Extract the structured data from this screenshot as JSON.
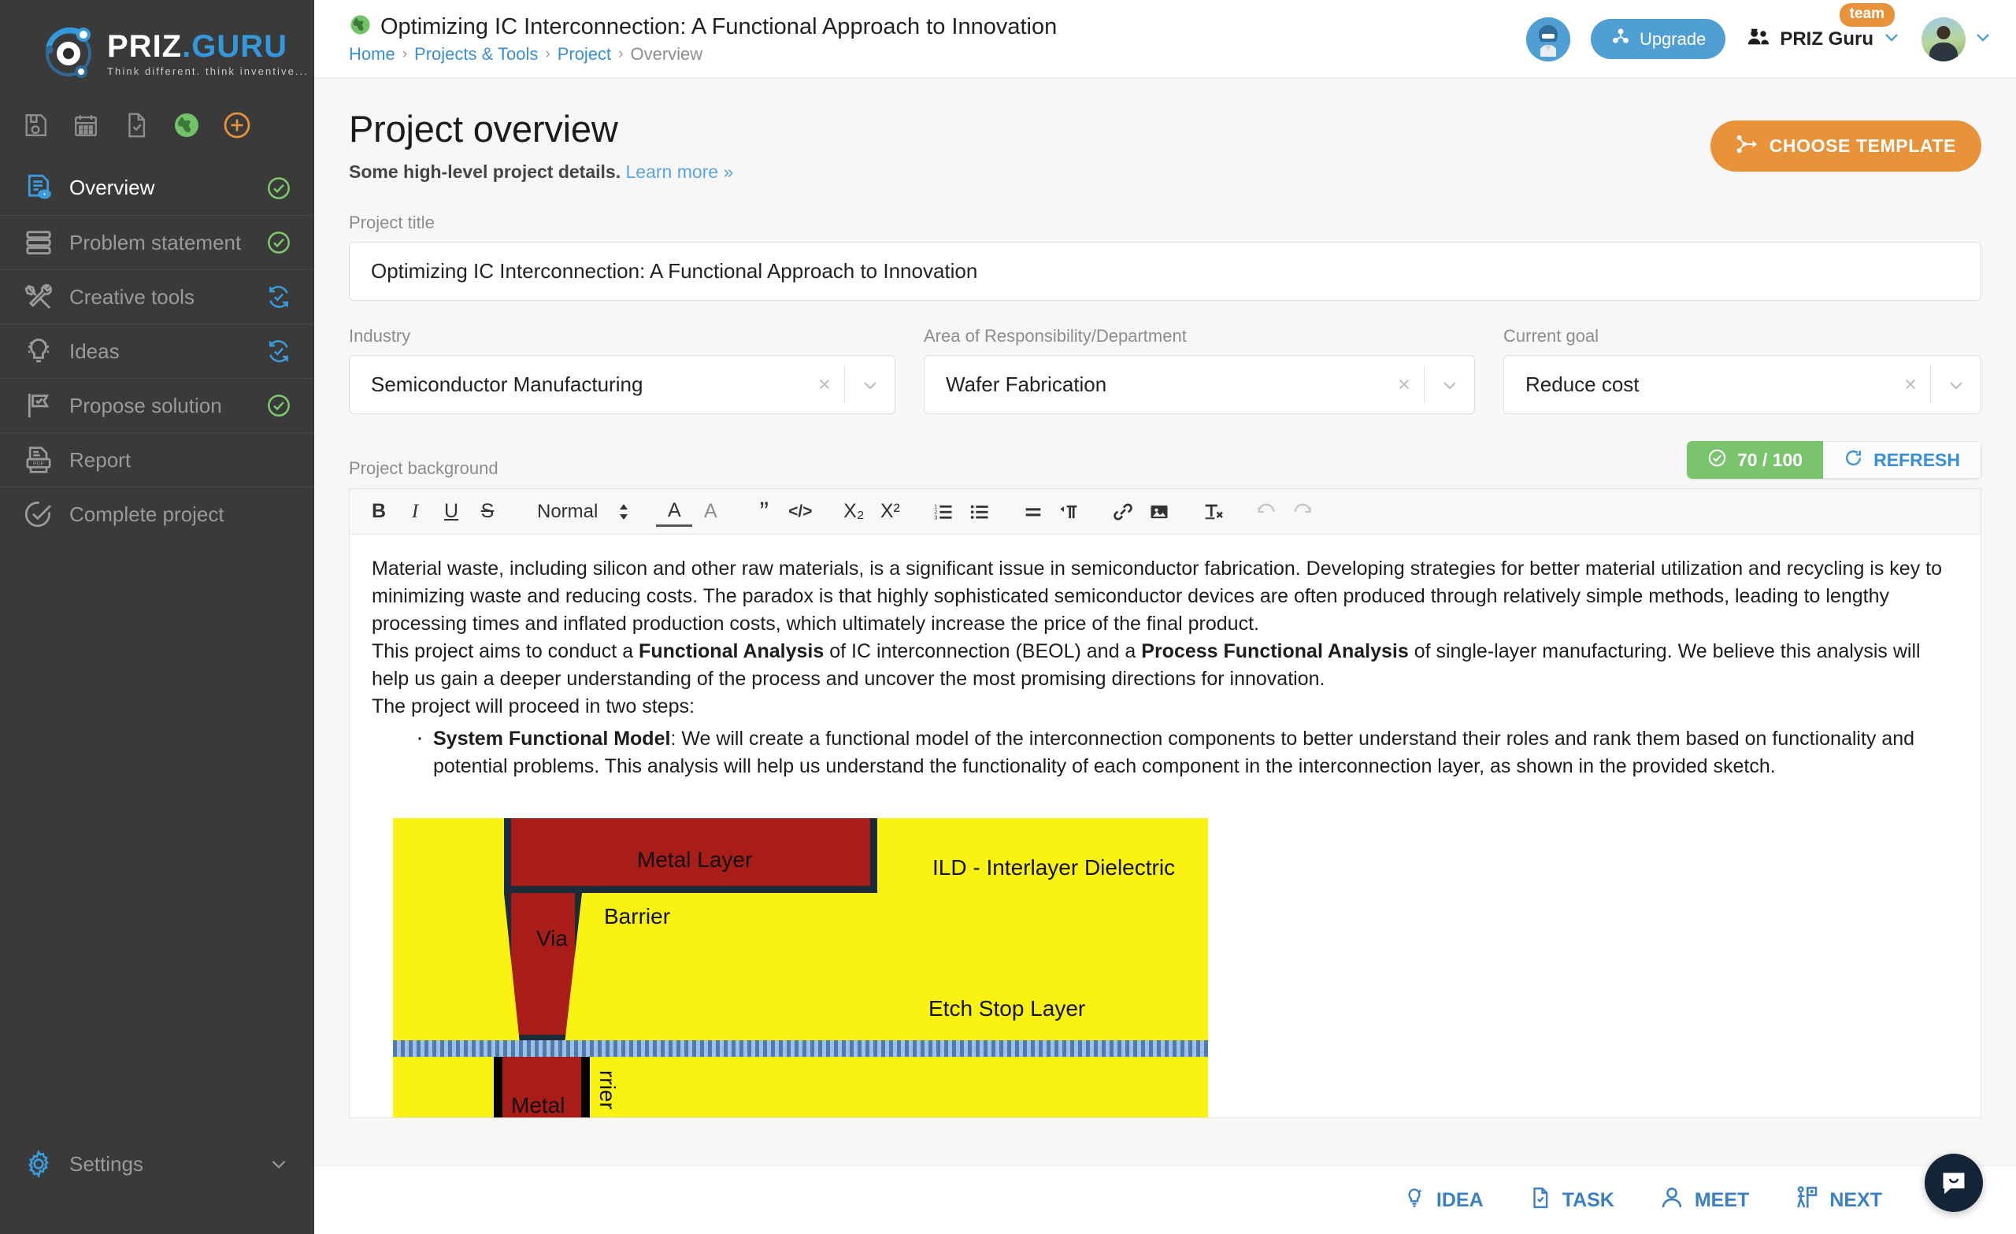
{
  "brand": {
    "name_white": "PRIZ",
    "name_blue": ".GURU",
    "tagline": "Think different. think inventive...",
    "logo_icon": "priz-orbit-logo-icon"
  },
  "sidebar": {
    "quick_icons": [
      {
        "name": "save-icon"
      },
      {
        "name": "calendar-icon"
      },
      {
        "name": "document-check-icon"
      },
      {
        "name": "globe-icon"
      },
      {
        "name": "add-circle-icon"
      }
    ],
    "items": [
      {
        "label": "Overview",
        "icon": "document-eye-icon",
        "status": "done",
        "active": true
      },
      {
        "label": "Problem statement",
        "icon": "stacked-rows-icon",
        "status": "done",
        "active": false
      },
      {
        "label": "Creative tools",
        "icon": "tools-icon",
        "status": "in-progress",
        "active": false
      },
      {
        "label": "Ideas",
        "icon": "lightbulb-icon",
        "status": "in-progress",
        "active": false
      },
      {
        "label": "Propose solution",
        "icon": "flag-check-icon",
        "status": "done",
        "active": false
      },
      {
        "label": "Report",
        "icon": "pdf-file-icon",
        "status": "none",
        "active": false
      },
      {
        "label": "Complete project",
        "icon": "check-circle-icon",
        "status": "none",
        "active": false
      }
    ],
    "settings": {
      "label": "Settings",
      "icon": "gear-icon",
      "chevron": "chevron-down-icon"
    }
  },
  "topbar": {
    "project_icon": "globe-icon",
    "title": "Optimizing IC Interconnection: A Functional Approach to Innovation",
    "breadcrumb": [
      {
        "label": "Home",
        "link": true
      },
      {
        "label": "Projects & Tools",
        "link": true
      },
      {
        "label": "Project",
        "link": true
      },
      {
        "label": "Overview",
        "link": false
      }
    ],
    "breadcrumb_separator": "›",
    "bot_avatar": "assistant-avatar",
    "upgrade_label": "Upgrade",
    "upgrade_icon": "upgrade-blocks-icon",
    "team_name": "PRIZ Guru",
    "team_icon": "people-icon",
    "team_badge": "team",
    "user_avatar": "user-avatar"
  },
  "page": {
    "title": "Project overview",
    "subtitle_bold": "Some high-level project details.",
    "subtitle_link": "Learn more »",
    "choose_template_label": "CHOOSE TEMPLATE",
    "choose_template_icon": "split-arrow-icon"
  },
  "form": {
    "project_title_label": "Project title",
    "project_title_value": "Optimizing IC Interconnection: A Functional Approach to Innovation",
    "project_title_placeholder": "Project title",
    "selects": [
      {
        "label": "Industry",
        "value": "Semiconductor Manufacturing",
        "clear": "×",
        "arrow": "chevron-down-icon"
      },
      {
        "label": "Area of Responsibility/Department",
        "value": "Wafer Fabrication",
        "clear": "×",
        "arrow": "chevron-down-icon"
      },
      {
        "label": "Current goal",
        "value": "Reduce cost",
        "clear": "×",
        "arrow": "chevron-down-icon"
      }
    ]
  },
  "background": {
    "label": "Project background",
    "score_value": "70 / 100",
    "score_icon": "check-circle-icon",
    "score_color": "#79c46d",
    "refresh_label": "REFRESH",
    "refresh_icon": "refresh-icon",
    "toolbar": [
      {
        "name": "bold-icon",
        "glyph": "B",
        "style": "bold"
      },
      {
        "name": "italic-icon",
        "glyph": "I",
        "style": "italic"
      },
      {
        "name": "underline-icon",
        "glyph": "U",
        "style": "underline"
      },
      {
        "name": "strikethrough-icon",
        "glyph": "S",
        "style": "strike"
      },
      {
        "name": "heading-select",
        "glyph": "Normal",
        "style": "picker"
      },
      {
        "name": "font-color-icon",
        "glyph": "A",
        "style": "colored"
      },
      {
        "name": "background-color-icon",
        "glyph": "A",
        "style": "hatched"
      },
      {
        "name": "blockquote-icon",
        "glyph": "”",
        "style": "plain"
      },
      {
        "name": "code-block-icon",
        "glyph": "</>",
        "style": "small"
      },
      {
        "name": "subscript-icon",
        "glyph": "X₂",
        "style": "plain"
      },
      {
        "name": "superscript-icon",
        "glyph": "X²",
        "style": "plain"
      },
      {
        "name": "ordered-list-icon",
        "glyph": "svg",
        "style": "svg"
      },
      {
        "name": "bullet-list-icon",
        "glyph": "svg",
        "style": "svg"
      },
      {
        "name": "align-icon",
        "glyph": "svg",
        "style": "svg"
      },
      {
        "name": "text-direction-icon",
        "glyph": "svg",
        "style": "svg"
      },
      {
        "name": "link-icon",
        "glyph": "svg",
        "style": "svg"
      },
      {
        "name": "image-icon",
        "glyph": "svg",
        "style": "svg"
      },
      {
        "name": "clear-format-icon",
        "glyph": "svg",
        "style": "svg"
      },
      {
        "name": "undo-icon",
        "glyph": "svg",
        "style": "svg-dim"
      },
      {
        "name": "redo-icon",
        "glyph": "svg",
        "style": "svg-dim"
      }
    ],
    "paragraph_1": "Material waste, including silicon and other raw materials, is a significant issue in semiconductor fabrication. Developing strategies for better material utilization and recycling is key to minimizing waste and reducing costs. The paradox is that highly sophisticated semiconductor devices are often produced through relatively simple methods, leading to lengthy processing times and inflated production costs, which ultimately increase the price of the final product.",
    "paragraph_2_a": "This project aims to conduct a ",
    "paragraph_2_b1": "Functional Analysis",
    "paragraph_2_c": " of IC interconnection (BEOL) and a ",
    "paragraph_2_b2": "Process Functional Analysis",
    "paragraph_2_d": " of single-layer manufacturing. We believe this analysis will help us gain a deeper understanding of the process and uncover the most promising directions for innovation.",
    "paragraph_3": "The project will proceed in two steps:",
    "bullet_1_bold": "System Functional Model",
    "bullet_1_text": ": We will create a functional model of the interconnection components to better understand their roles and rank them based on functionality and potential problems. This analysis will help us understand the functionality of each component in the interconnection layer, as shown in the provided sketch.",
    "sketch": {
      "labels": {
        "metal_layer": "Metal Layer",
        "ild": "ILD - Interlayer Dielectric",
        "barrier_top": "Barrier",
        "via": "Via",
        "etch_stop": "Etch Stop Layer",
        "metal_bottom": "Metal",
        "barrier_bottom": "rrier"
      },
      "colors": {
        "dielectric": "#faf211",
        "metal": "#a81d18",
        "barrier": "#1c2b3a",
        "etch_stop": "#4f7bb0"
      }
    }
  },
  "bottombar": {
    "items": [
      {
        "label": "IDEA",
        "icon": "idea-bulb-icon"
      },
      {
        "label": "TASK",
        "icon": "task-file-icon"
      },
      {
        "label": "MEET",
        "icon": "person-icon"
      },
      {
        "label": "NEXT",
        "icon": "next-flag-icon"
      }
    ],
    "chat_icon": "chat-bubble-icon"
  }
}
